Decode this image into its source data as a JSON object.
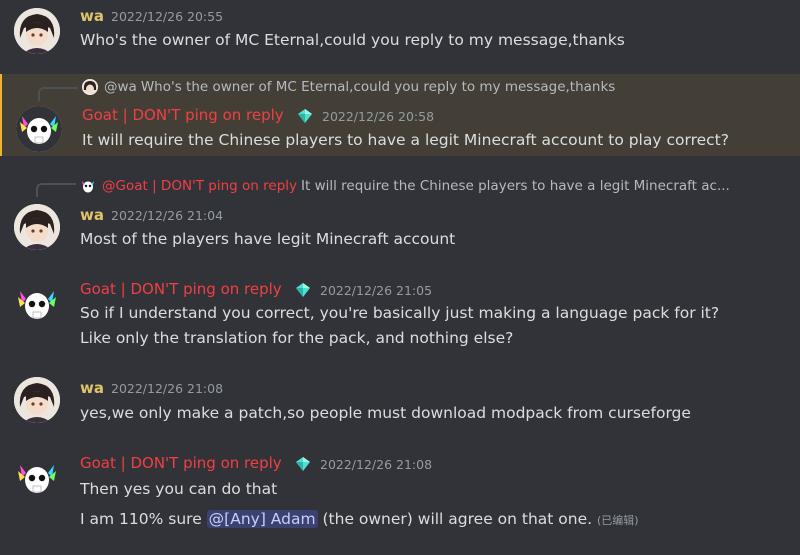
{
  "messages": [
    {
      "author": "wa",
      "timestamp": "2022/12/26 20:55",
      "lines": [
        "Who's the owner of MC Eternal,could you reply to my message,thanks"
      ]
    },
    {
      "reply_to": {
        "author": "@wa",
        "text": "Who's the owner of MC Eternal,could you reply to my message,thanks"
      },
      "author": "Goat | DON'T ping on reply",
      "timestamp": "2022/12/26 20:58",
      "lines": [
        "It will require the Chinese players to have a legit Minecraft account to play correct?"
      ]
    },
    {
      "reply_to": {
        "author": "@Goat | DON'T ping on reply",
        "text": "It will require the Chinese players to have a legit Minecraft ac..."
      },
      "author": "wa",
      "timestamp": "2022/12/26 21:04",
      "lines": [
        "Most of the players have legit Minecraft account"
      ]
    },
    {
      "author": "Goat | DON'T ping on reply",
      "timestamp": "2022/12/26 21:05",
      "lines": [
        "So if I understand you correct, you're basically just making a language pack for it?",
        "Like only the translation for the pack, and nothing else?"
      ]
    },
    {
      "author": "wa",
      "timestamp": "2022/12/26 21:08",
      "lines": [
        "yes,we only make a patch,so people must download modpack from curseforge"
      ]
    },
    {
      "author": "Goat | DON'T ping on reply",
      "timestamp": "2022/12/26 21:08",
      "lines": [
        "Then yes you can do that"
      ],
      "last_line": {
        "before": "I am 110% sure ",
        "mention": "@[Any] Adam",
        "after": " (the owner) will agree on that one.",
        "edited": "(已编辑)"
      }
    }
  ],
  "colors": {
    "background": "#313338",
    "highlight_bg": "#433f36",
    "wa_name": "#dfc46a",
    "goat_name": "#f23f43",
    "mention_bg": "#3c4270"
  },
  "icons": {
    "role_icon": "diamond-gem-icon"
  }
}
